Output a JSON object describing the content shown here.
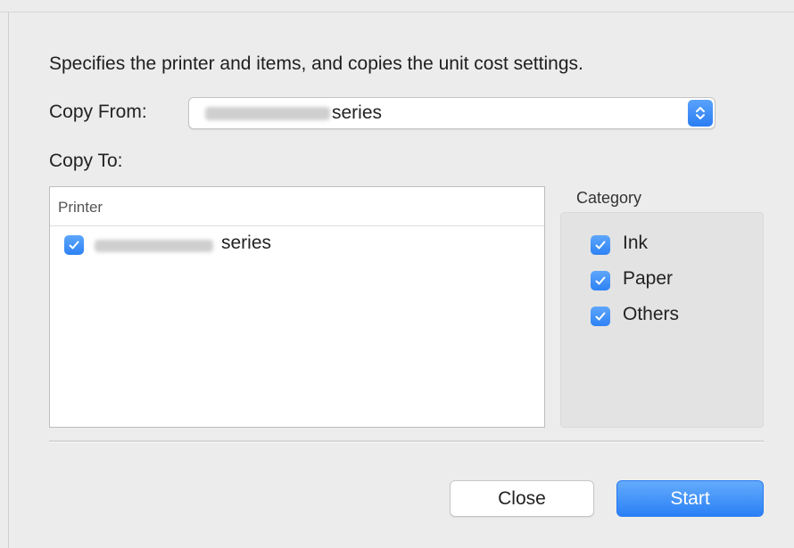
{
  "dialog": {
    "description": "Specifies the printer and items, and copies the unit cost settings."
  },
  "copy_from": {
    "label": "Copy From:",
    "selected_value": "series",
    "icon": "popup-stepper-icon"
  },
  "copy_to": {
    "label": "Copy To:",
    "table": {
      "column_header": "Printer",
      "rows": [
        {
          "checked": true,
          "name": "series"
        }
      ]
    }
  },
  "category": {
    "title": "Category",
    "items": [
      {
        "label": "Ink",
        "checked": true
      },
      {
        "label": "Paper",
        "checked": true
      },
      {
        "label": "Others",
        "checked": true
      }
    ]
  },
  "buttons": {
    "close_label": "Close",
    "start_label": "Start"
  },
  "colors": {
    "accent": "#2a80f5",
    "window_bg": "#ececec"
  }
}
